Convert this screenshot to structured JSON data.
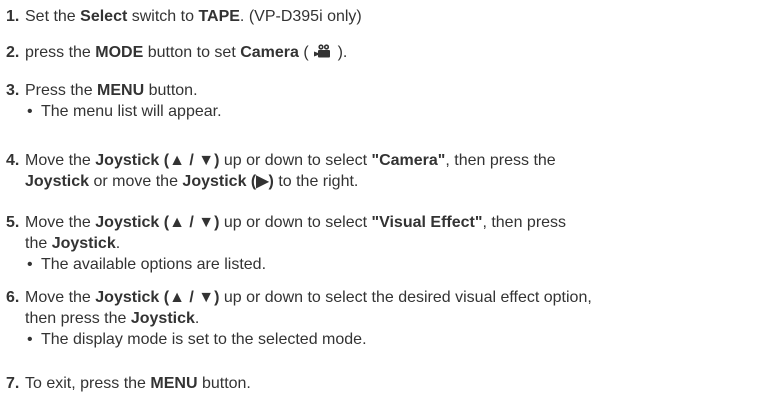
{
  "steps": [
    {
      "num": "1.",
      "segments": [
        {
          "t": "Set the ",
          "b": false
        },
        {
          "t": "Select",
          "b": true
        },
        {
          "t": " switch to ",
          "b": false
        },
        {
          "t": "TAPE",
          "b": true
        },
        {
          "t": ". (VP-D395i only)",
          "b": false
        }
      ]
    },
    {
      "num": "2.",
      "segments": [
        {
          "t": "press the ",
          "b": false
        },
        {
          "t": "MODE",
          "b": true
        },
        {
          "t": " button to set ",
          "b": false
        },
        {
          "t": "Camera",
          "b": true
        },
        {
          "t": " ( ",
          "b": false
        },
        {
          "icon": "camera-mode-icon"
        },
        {
          "t": " ).",
          "b": false
        }
      ]
    },
    {
      "num": "3.",
      "segments": [
        {
          "t": "Press the ",
          "b": false
        },
        {
          "t": "MENU",
          "b": true
        },
        {
          "t": " button.",
          "b": false
        }
      ],
      "bullets": [
        "The menu list will appear."
      ]
    },
    {
      "num": "4.",
      "segments": [
        {
          "t": "Move the ",
          "b": false
        },
        {
          "t": "Joystick (▲ / ▼)",
          "b": true
        },
        {
          "t": " up or down to select ",
          "b": false
        },
        {
          "t": "\"Camera\"",
          "b": true
        },
        {
          "t": ", then press the",
          "b": false
        },
        {
          "br": true
        },
        {
          "t": "Joystick",
          "b": true
        },
        {
          "t": " or move the ",
          "b": false
        },
        {
          "t": "Joystick (▶)",
          "b": true
        },
        {
          "t": " to the right.",
          "b": false
        }
      ]
    },
    {
      "num": "5.",
      "segments": [
        {
          "t": "Move the ",
          "b": false
        },
        {
          "t": "Joystick (▲ / ▼)",
          "b": true
        },
        {
          "t": " up or down to select ",
          "b": false
        },
        {
          "t": "\"Visual Effect\"",
          "b": true
        },
        {
          "t": ", then press",
          "b": false
        },
        {
          "br": true
        },
        {
          "t": "the ",
          "b": false
        },
        {
          "t": "Joystick",
          "b": true
        },
        {
          "t": ".",
          "b": false
        }
      ],
      "bullets": [
        "The available options are listed."
      ]
    },
    {
      "num": "6.",
      "segments": [
        {
          "t": "Move the ",
          "b": false
        },
        {
          "t": "Joystick (▲ / ▼)",
          "b": true
        },
        {
          "t": " up or down to select the desired visual effect option,",
          "b": false
        },
        {
          "br": true
        },
        {
          "t": "then press the ",
          "b": false
        },
        {
          "t": "Joystick",
          "b": true
        },
        {
          "t": ".",
          "b": false
        }
      ],
      "bullets": [
        "The display mode is set to the selected mode."
      ]
    },
    {
      "num": "7.",
      "segments": [
        {
          "t": "To exit, press the ",
          "b": false
        },
        {
          "t": "MENU",
          "b": true
        },
        {
          "t": " button.",
          "b": false
        }
      ]
    }
  ],
  "bullet_symbol": "•",
  "colors": {
    "text": "#333333",
    "background": "#ffffff"
  }
}
